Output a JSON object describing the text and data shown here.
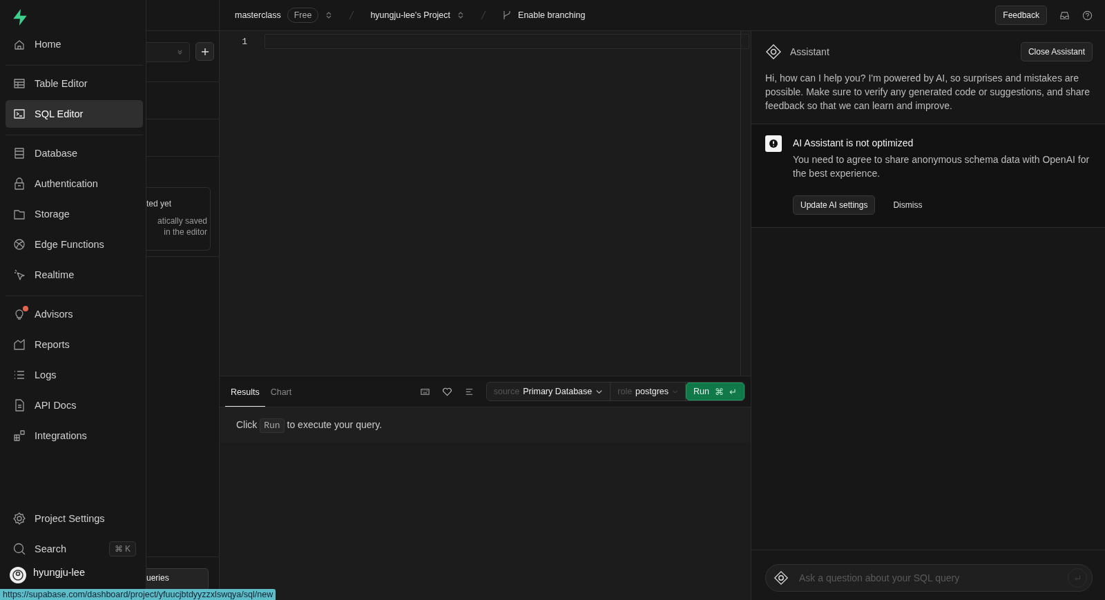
{
  "sidebar": {
    "groups": [
      [
        {
          "label": "Home",
          "selected": false,
          "notification": false
        }
      ],
      [
        {
          "label": "Table Editor",
          "selected": false,
          "notification": false
        },
        {
          "label": "SQL Editor",
          "selected": true,
          "notification": false
        }
      ],
      [
        {
          "label": "Database",
          "selected": false,
          "notification": false
        },
        {
          "label": "Authentication",
          "selected": false,
          "notification": false
        },
        {
          "label": "Storage",
          "selected": false,
          "notification": false
        },
        {
          "label": "Edge Functions",
          "selected": false,
          "notification": false
        },
        {
          "label": "Realtime",
          "selected": false,
          "notification": false
        }
      ],
      [
        {
          "label": "Advisors",
          "selected": false,
          "notification": true
        },
        {
          "label": "Reports",
          "selected": false,
          "notification": false
        },
        {
          "label": "Logs",
          "selected": false,
          "notification": false
        },
        {
          "label": "API Docs",
          "selected": false,
          "notification": false
        },
        {
          "label": "Integrations",
          "selected": false,
          "notification": false
        }
      ]
    ],
    "settings": "Project Settings",
    "search": "Search",
    "search_shortcut": "⌘ K",
    "user": "hyungju-lee"
  },
  "topbar": {
    "org": "masterclass",
    "plan": "Free",
    "project": "hyungju-lee's Project",
    "branching": "Enable branching",
    "feedback": "Feedback"
  },
  "side_panel": {
    "empty_title": "ted yet",
    "empty_lines": [
      "atically saved",
      "in the editor"
    ],
    "bottom_button": "ueries"
  },
  "editor": {
    "line_numbers": [
      "1"
    ]
  },
  "results": {
    "tabs": [
      {
        "label": "Results",
        "selected": true
      },
      {
        "label": "Chart",
        "selected": false
      }
    ],
    "source_label": "source",
    "source": "Primary Database",
    "role_label": "role",
    "role": "postgres",
    "run": "Run",
    "run_keys": [
      "⌘",
      "↵"
    ],
    "message_prefix": "Click",
    "message_key": "Run",
    "message_suffix": "to execute your query."
  },
  "assistant": {
    "title": "Assistant",
    "close_button": "Close Assistant",
    "intro": "Hi, how can I help you? I'm powered by AI, so surprises and mistakes are possible. Make sure to verify any generated code or suggestions, and share feedback so that we can learn and improve.",
    "notice": {
      "title": "AI Assistant is not optimized",
      "body": "You need to agree to share anonymous schema data with OpenAI for the best experience.",
      "primary_button": "Update AI settings",
      "secondary_button": "Dismiss"
    },
    "input": {
      "placeholder": "Ask a question about your SQL query"
    }
  },
  "status_url": "https://supabase.com/dashboard/project/yfuucjbtdyyzzxlswqya/sql/new"
}
